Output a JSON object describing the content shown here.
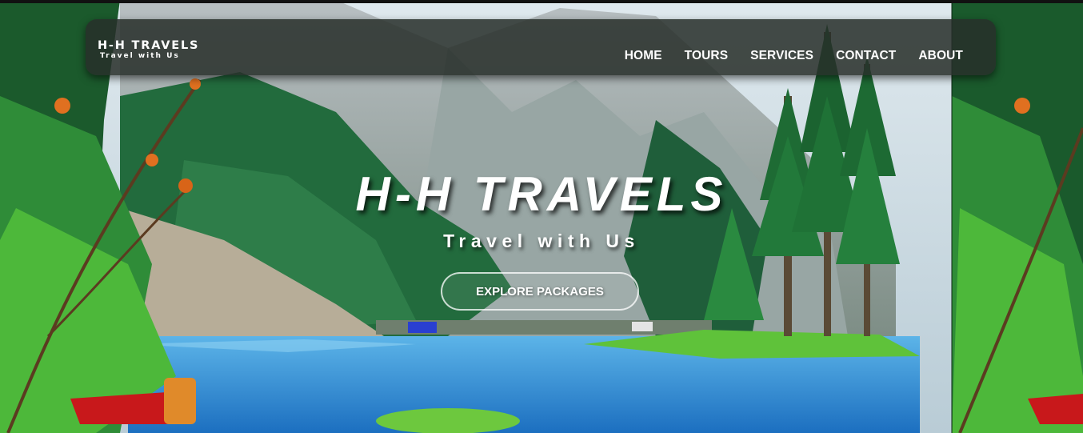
{
  "brand": {
    "title": "H-H TRAVELS",
    "subtitle": "Travel with Us"
  },
  "nav": {
    "items": [
      {
        "label": "HOME"
      },
      {
        "label": "TOURS"
      },
      {
        "label": "SERVICES"
      },
      {
        "label": "CONTACT"
      },
      {
        "label": "ABOUT"
      }
    ]
  },
  "hero": {
    "title": "H-H TRAVELS",
    "subtitle": "Travel with Us",
    "cta_label": "EXPLORE PACKAGES",
    "background": "mountain-lake-forest-photo"
  },
  "colors": {
    "navbar_bg": "#282e2a",
    "text": "#ffffff",
    "lake": "#2f8fd6",
    "forest": "#1f6a3c",
    "mountain": "#8ea0a8"
  }
}
